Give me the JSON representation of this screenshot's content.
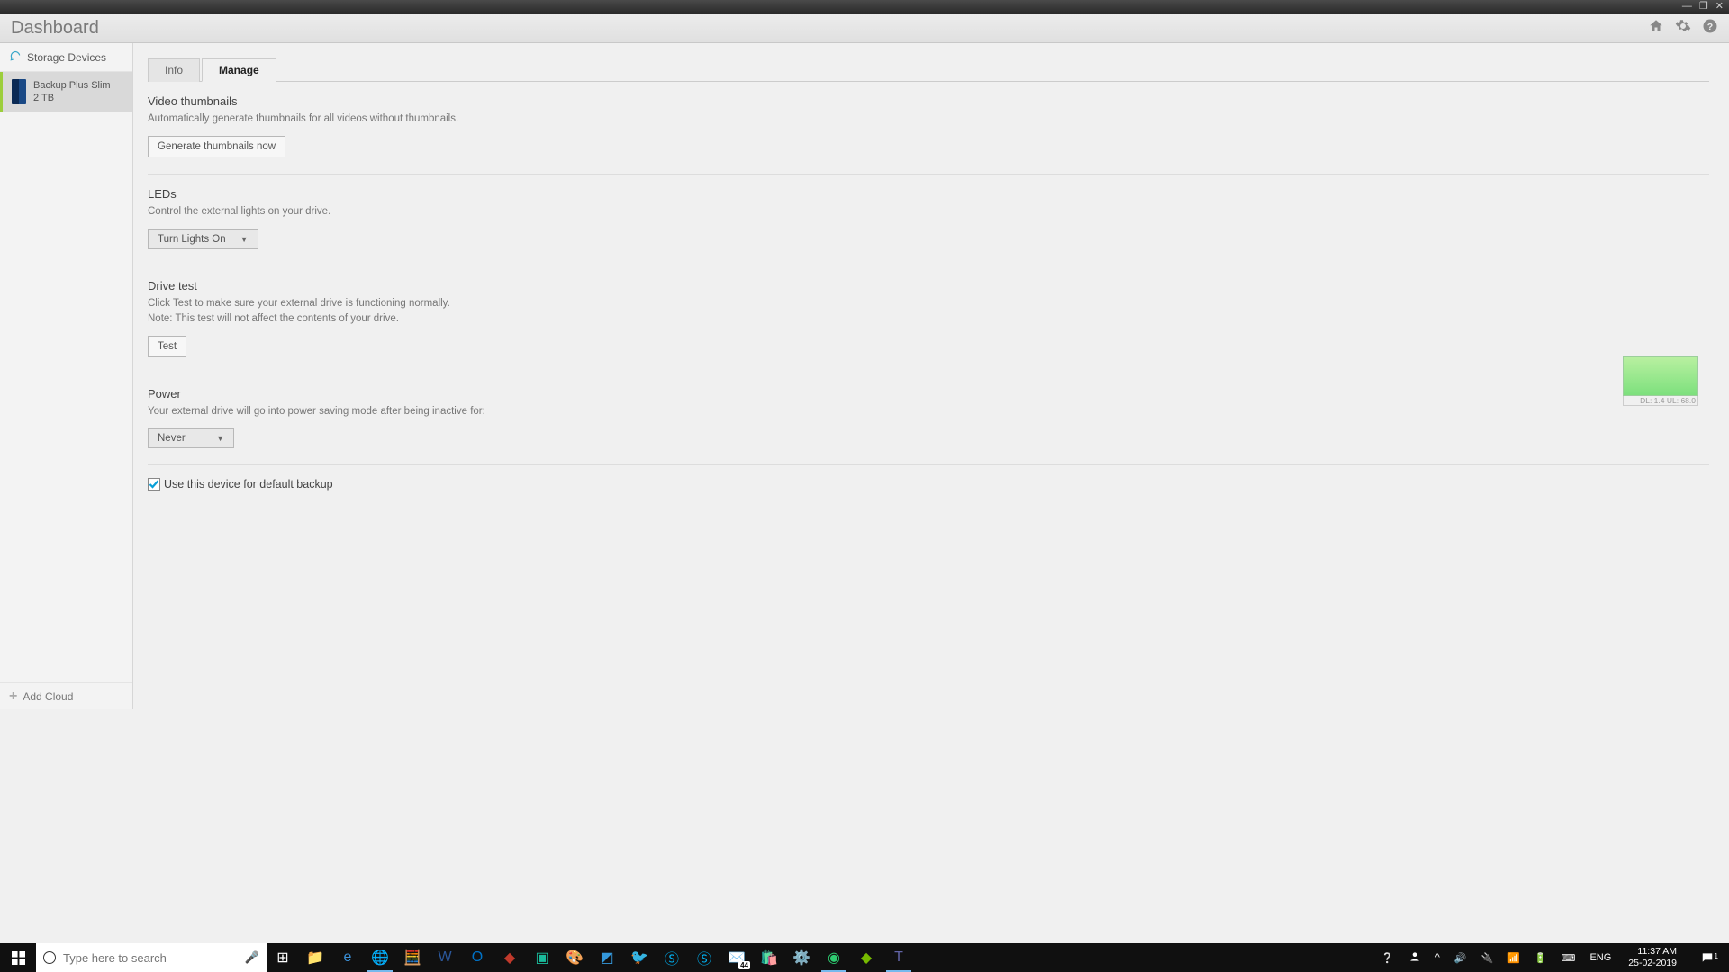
{
  "window": {
    "title": "Dashboard"
  },
  "header_icons": {
    "home": "home-icon",
    "settings": "gear-icon",
    "help": "help-icon"
  },
  "sidebar": {
    "header": "Storage Devices",
    "device": {
      "name": "Backup Plus Slim",
      "capacity": "2 TB"
    },
    "add_cloud": "Add Cloud"
  },
  "tabs": {
    "info": "Info",
    "manage": "Manage"
  },
  "sections": {
    "video": {
      "title": "Video thumbnails",
      "desc": "Automatically generate thumbnails for all videos without thumbnails.",
      "button": "Generate thumbnails now"
    },
    "leds": {
      "title": "LEDs",
      "desc": "Control the external lights on your drive.",
      "selected": "Turn Lights On"
    },
    "drivetest": {
      "title": "Drive test",
      "desc1": "Click Test to make sure your external drive is functioning normally.",
      "desc2": "Note: This test will not affect the contents of your drive.",
      "button": "Test"
    },
    "power": {
      "title": "Power",
      "desc": "Your external drive will go into power saving mode after being inactive for:",
      "selected": "Never"
    },
    "default_backup": {
      "label": "Use this device for default backup",
      "checked": true
    }
  },
  "net_monitor": "DL: 1.4 UL: 68.0",
  "taskbar": {
    "search_placeholder": "Type here to search",
    "lang": "ENG",
    "time": "11:37 AM",
    "date": "25-02-2019",
    "mail_badge": "44",
    "notif_count": "1"
  }
}
